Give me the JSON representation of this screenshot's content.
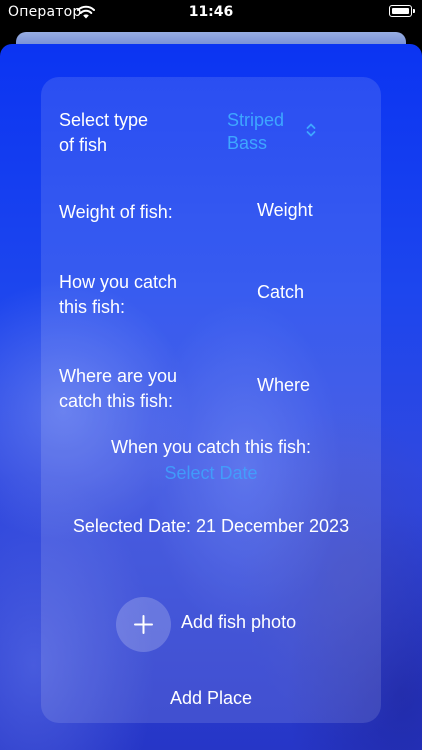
{
  "status_bar": {
    "carrier": "Оператор",
    "time": "11:46"
  },
  "form": {
    "fish_type_label": "Select type\nof fish",
    "fish_type_value": "Striped\nBass",
    "weight_label": "Weight of fish:",
    "weight_value": "Weight",
    "catch_label": "How you catch\nthis fish:",
    "catch_value": "Catch",
    "where_label": "Where are you\ncatch this fish:",
    "where_value": "Where",
    "date_title": "When you catch this fish:",
    "select_date_button": "Select Date",
    "selected_date": "Selected Date: 21 December 2023",
    "add_photo_label": "Add fish photo",
    "add_place_button": "Add Place"
  },
  "colors": {
    "background_blue": "#1d46ee",
    "accent_blue": "#3ea7ff",
    "text": "#ffffff"
  },
  "icons": {
    "wifi": "wifi-icon",
    "battery": "battery-icon",
    "picker": "chevron-up-down-icon",
    "add": "plus-icon"
  }
}
